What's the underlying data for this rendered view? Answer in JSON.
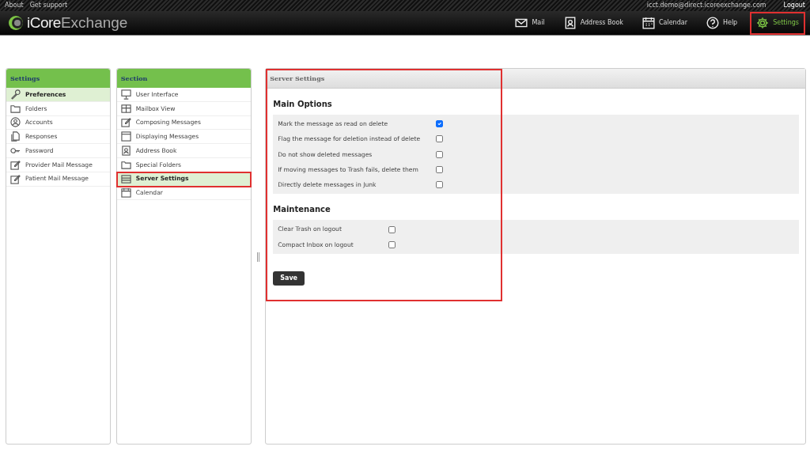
{
  "top_links": [
    "About",
    "Get support"
  ],
  "user_email": "icct.demo@direct.icoreexchange.com",
  "logout": "Logout",
  "logo": {
    "bold": "iCore",
    "light": "Exchange"
  },
  "nav": [
    {
      "label": "Mail",
      "selected": false,
      "highlighted": false
    },
    {
      "label": "Address Book",
      "selected": false,
      "highlighted": false
    },
    {
      "label": "Calendar",
      "selected": false,
      "highlighted": false
    },
    {
      "label": "Help",
      "selected": false,
      "highlighted": false
    },
    {
      "label": "Settings",
      "selected": true,
      "highlighted": true
    }
  ],
  "settings_panel": {
    "title": "Settings",
    "items": [
      {
        "label": "Preferences",
        "selected": true
      },
      {
        "label": "Folders",
        "selected": false
      },
      {
        "label": "Accounts",
        "selected": false
      },
      {
        "label": "Responses",
        "selected": false
      },
      {
        "label": "Password",
        "selected": false
      },
      {
        "label": "Provider Mail Message",
        "selected": false
      },
      {
        "label": "Patient Mail Message",
        "selected": false
      }
    ]
  },
  "section_panel": {
    "title": "Section",
    "items": [
      {
        "label": "User Interface",
        "selected": false,
        "highlighted": false
      },
      {
        "label": "Mailbox View",
        "selected": false,
        "highlighted": false
      },
      {
        "label": "Composing Messages",
        "selected": false,
        "highlighted": false
      },
      {
        "label": "Displaying Messages",
        "selected": false,
        "highlighted": false
      },
      {
        "label": "Address Book",
        "selected": false,
        "highlighted": false
      },
      {
        "label": "Special Folders",
        "selected": false,
        "highlighted": false
      },
      {
        "label": "Server Settings",
        "selected": true,
        "highlighted": true
      },
      {
        "label": "Calendar",
        "selected": false,
        "highlighted": false
      }
    ]
  },
  "content": {
    "title": "Server Settings",
    "highlighted": true,
    "groups": [
      {
        "heading": "Main Options",
        "options": [
          {
            "label": "Mark the message as read on delete",
            "checked": true
          },
          {
            "label": "Flag the message for deletion instead of delete",
            "checked": false
          },
          {
            "label": "Do not show deleted messages",
            "checked": false
          },
          {
            "label": "If moving messages to Trash fails, delete them",
            "checked": false
          },
          {
            "label": "Directly delete messages in Junk",
            "checked": false
          }
        ]
      },
      {
        "heading": "Maintenance",
        "options": [
          {
            "label": "Clear Trash on logout",
            "checked": false
          },
          {
            "label": "Compact Inbox on logout",
            "checked": false
          }
        ]
      }
    ],
    "save": "Save"
  }
}
